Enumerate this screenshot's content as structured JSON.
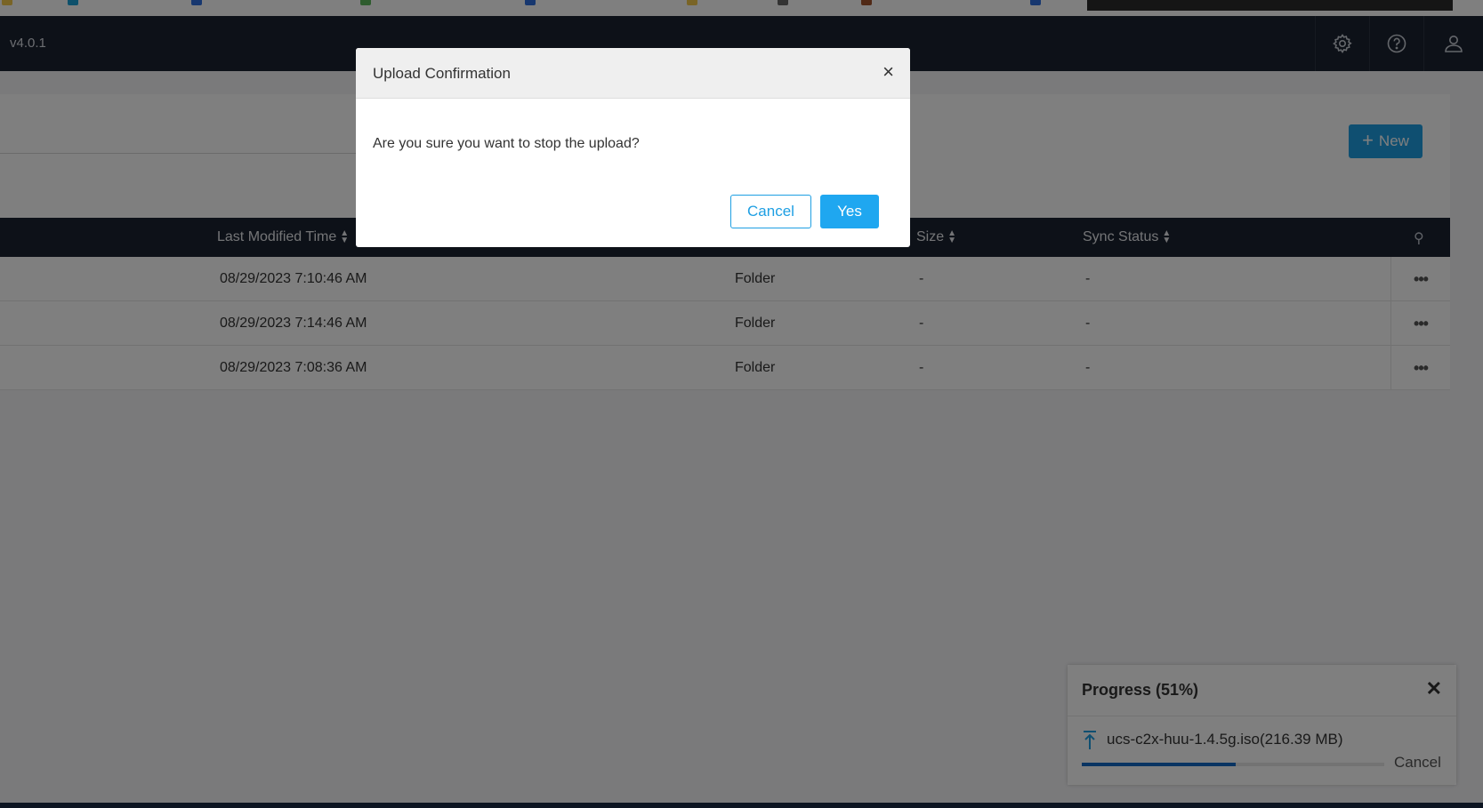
{
  "app": {
    "version": "v4.0.1"
  },
  "header": {
    "icons": [
      "gear-icon",
      "help-icon",
      "user-icon"
    ]
  },
  "toolbar": {
    "new_label": "New"
  },
  "table": {
    "columns": [
      "Last Modified Time",
      "Size",
      "Sync Status"
    ],
    "rows": [
      {
        "modified": "08/29/2023 7:10:46 AM",
        "type": "Folder",
        "size": "-",
        "sync": "-"
      },
      {
        "modified": "08/29/2023 7:14:46 AM",
        "type": "Folder",
        "size": "-",
        "sync": "-"
      },
      {
        "modified": "08/29/2023 7:08:36 AM",
        "type": "Folder",
        "size": "-",
        "sync": "-"
      }
    ]
  },
  "modal": {
    "title": "Upload Confirmation",
    "close": "×",
    "message": "Are you sure you want to stop the upload?",
    "cancel_label": "Cancel",
    "yes_label": "Yes"
  },
  "progress": {
    "title": "Progress (51%)",
    "percent": 51,
    "close": "✕",
    "file": "ucs-c2x-huu-1.4.5g.iso(216.39 MB)",
    "cancel_label": "Cancel"
  },
  "colors": {
    "accent": "#1e9fe3",
    "header_bg": "#1b2230",
    "progress_fill": "#1269c4"
  }
}
